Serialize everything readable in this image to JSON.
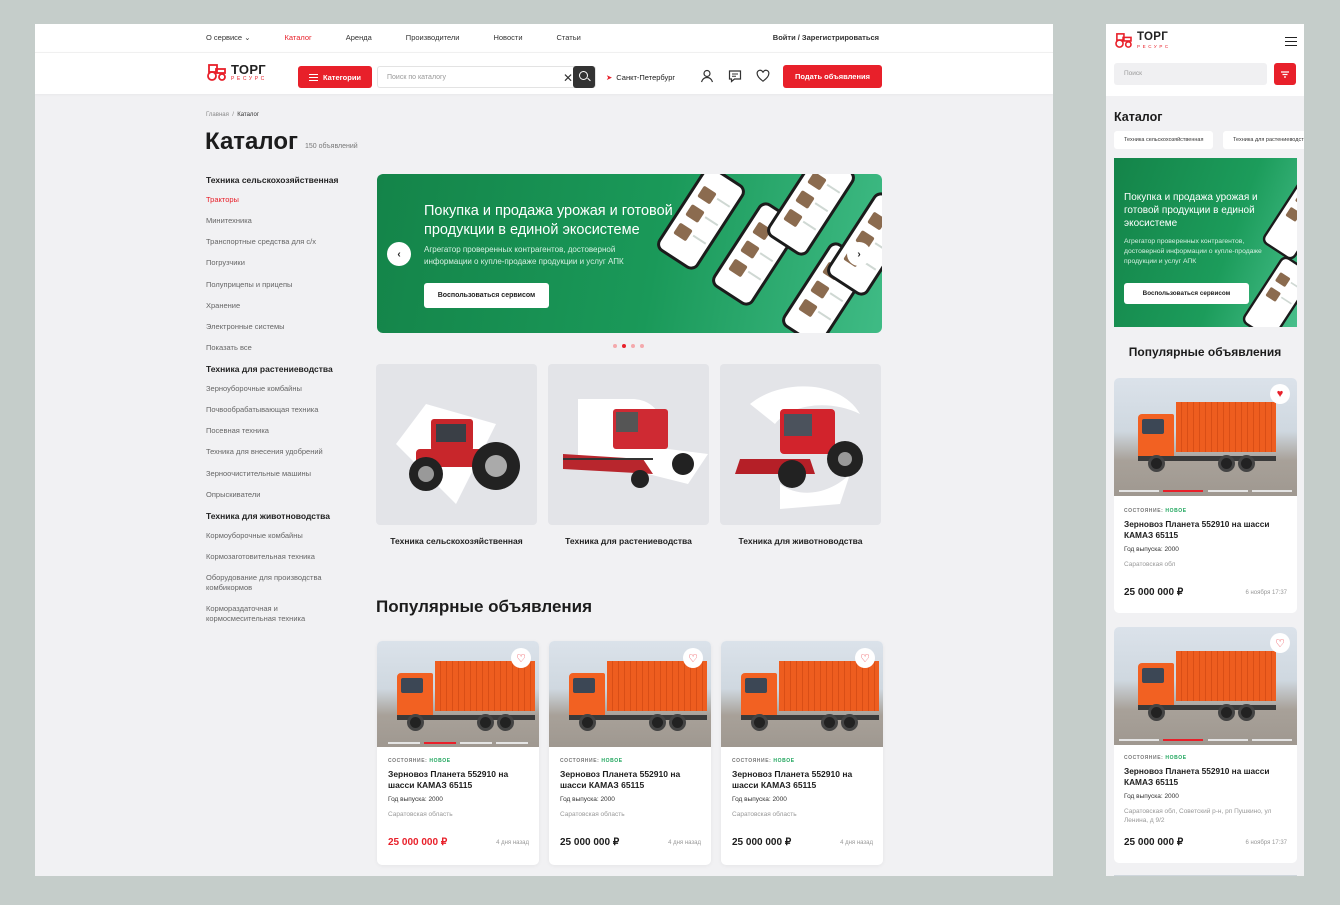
{
  "brand": {
    "name": "ТОРГ",
    "sub": "РЕСУРС"
  },
  "topnav": {
    "items": [
      "О сервисе ⌄",
      "Каталог",
      "Аренда",
      "Производители",
      "Новости",
      "Статьи"
    ],
    "login": "Войти / Зарегистрироваться"
  },
  "header": {
    "categories_btn": "Категории",
    "search_placeholder": "Поиск по каталогу",
    "city": "Санкт-Петербург",
    "post_btn": "Подать объявления"
  },
  "breadcrumb": {
    "home": "Главная",
    "sep": "/",
    "current": "Каталог"
  },
  "page": {
    "title": "Каталог",
    "count": "150 объявлений"
  },
  "sidebar": [
    {
      "title": "Техника сельскохозяйственная",
      "items": [
        "Тракторы",
        "Минитехника",
        "Транспортные средства для с/х",
        "Погрузчики",
        "Полуприцепы и прицепы",
        "Хранение",
        "Электронные системы",
        "Показать все"
      ]
    },
    {
      "title": "Техника для растениеводства",
      "items": [
        "Зерноуборочные комбайны",
        "Почвообрабатывающая техника",
        "Посевная техника",
        "Техника для внесения удобрений",
        "Зерноочистительные машины",
        "Опрыскиватели"
      ]
    },
    {
      "title": "Техника для животноводства",
      "items": [
        "Кормоуборочные комбайны",
        "Кормозаготовительная техника",
        "Оборудование для производства комбикормов",
        "Кормораздаточная и кормосмесительная техника"
      ]
    }
  ],
  "banner": {
    "headline": "Покупка и продажа урожая и готовой продукции в единой экосистеме",
    "text": "Агрегатор проверенных контрагентов, достоверной информации о купле-продаже продукции и услуг АПК",
    "cta": "Воспользоваться сервисом",
    "prev": "‹",
    "next": "›",
    "slides": 4,
    "active_slide": 2
  },
  "categories": [
    "Техника сельскохозяйственная",
    "Техника для растениеводства",
    "Техника для животноводства"
  ],
  "popular": {
    "title": "Популярные объявления",
    "state_label": "СОСТОЯНИЕ:",
    "state_value": "НОВОЕ",
    "cards": [
      {
        "name": "Зерновоз Планета 552910 на шасси КАМАЗ 65115",
        "year": "Год выпуска: 2000",
        "region": "Саратовская область",
        "price": "25 000 000 ₽",
        "date": "4 дня назад",
        "price_red": true
      },
      {
        "name": "Зерновоз Планета 552910 на шасси КАМАЗ 65115",
        "year": "Год выпуска: 2000",
        "region": "Саратовская область",
        "price": "25 000 000 ₽",
        "date": "4 дня назад",
        "price_red": false
      },
      {
        "name": "Зерновоз Планета 552910 на шасси КАМАЗ 65115",
        "year": "Год выпуска: 2000",
        "region": "Саратовская область",
        "price": "25 000 000 ₽",
        "date": "4 дня назад",
        "price_red": false
      }
    ]
  },
  "mobile": {
    "search_placeholder": "Поиск",
    "title": "Каталог",
    "chips": [
      "Техника сельскохозяйственная",
      "Техника для растениеводства"
    ],
    "banner_headline": "Покупка и продажа урожая и готовой продукции в единой экосистеме",
    "banner_text": "Агрегатор проверенных контрагентов, достоверной информации о купле-продаже продукции и услуг АПК",
    "banner_cta": "Воспользоваться сервисом",
    "popular_title": "Популярные объявления",
    "cards": [
      {
        "name": "Зерновоз Планета 552910 на шасси КАМАЗ 65115",
        "year": "Год выпуска: 2000",
        "region": "Саратовская обл",
        "price": "25 000 000 ₽",
        "date": "6 ноября 17:37",
        "favorited": true
      },
      {
        "name": "Зерновоз Планета 552910 на шасси КАМАЗ 65115",
        "year": "Год выпуска: 2000",
        "region": "Саратовская обл, Советский р-н, рп Пушкино, ул Ленина, д 9/2",
        "price": "25 000 000 ₽",
        "date": "6 ноября 17:37",
        "favorited": false
      }
    ]
  },
  "colors": {
    "accent": "#e8202a",
    "green": "#1a9959",
    "background": "#f1f1f3",
    "outer": "#c5cdca"
  }
}
